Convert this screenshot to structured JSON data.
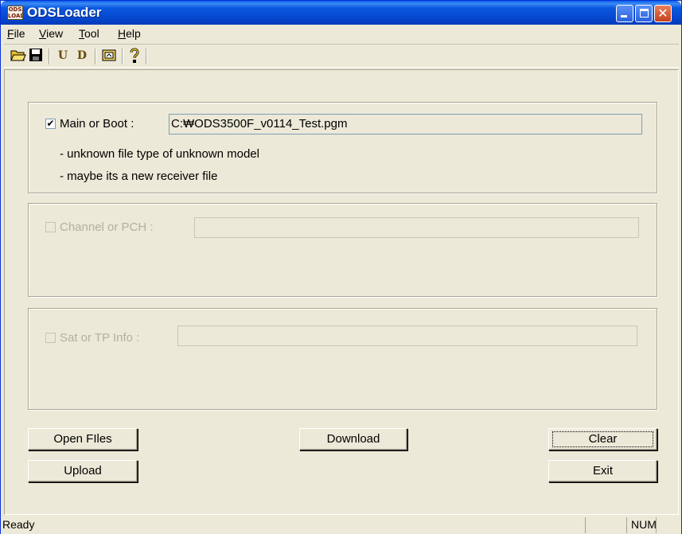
{
  "window": {
    "title": "ODSLoader",
    "icon_label": "ODS LOADER"
  },
  "menu": [
    "File",
    "View",
    "Tool",
    "Help"
  ],
  "menu_mnemonics": [
    "F",
    "V",
    "T",
    "H"
  ],
  "toolbar": {
    "items": [
      "open-folder-icon",
      "save-disk-icon",
      "upload-u-icon",
      "download-d-icon",
      "receiver-icon",
      "help-question-icon"
    ],
    "glyphs": [
      "📂",
      "💾",
      "U",
      "D",
      "▣",
      "?"
    ]
  },
  "main_group": {
    "checkbox_checked": true,
    "label": "Main or Boot :",
    "path": "C:₩ODS3500F_v0114_Test.pgm",
    "messages": [
      "- unknown file type of unknown model",
      "- maybe its a new receiver file"
    ]
  },
  "channel_group": {
    "checkbox_checked": false,
    "label": "Channel or PCH :",
    "path": ""
  },
  "sat_group": {
    "checkbox_checked": false,
    "label": "Sat or TP Info :",
    "path": ""
  },
  "buttons": {
    "open_files": "Open FIles",
    "download": "Download",
    "clear": "Clear",
    "upload": "Upload",
    "exit": "Exit"
  },
  "status": {
    "text": "Ready",
    "num": "NUM"
  },
  "colors": {
    "titlebar": "#0a58e0",
    "face": "#ece9d8",
    "disabled_text": "#b3b0a2"
  }
}
